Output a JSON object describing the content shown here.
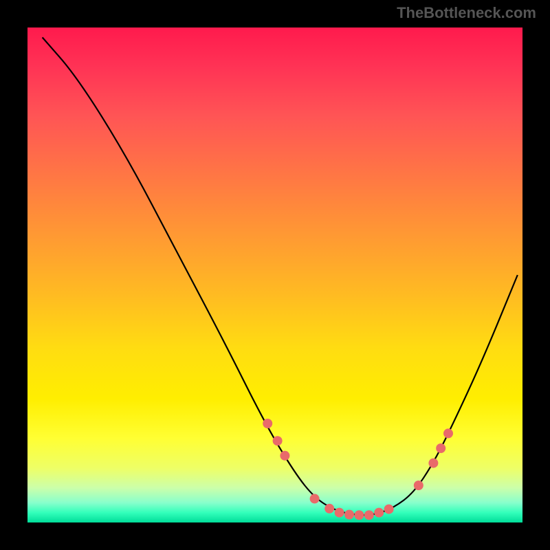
{
  "attribution": "TheBottleneck.com",
  "chart_data": {
    "type": "line",
    "title": "",
    "xlabel": "",
    "ylabel": "",
    "xlim": [
      0,
      100
    ],
    "ylim": [
      0,
      100
    ],
    "curve": [
      {
        "x": 3,
        "y": 98
      },
      {
        "x": 10,
        "y": 90
      },
      {
        "x": 20,
        "y": 74
      },
      {
        "x": 30,
        "y": 55
      },
      {
        "x": 40,
        "y": 36
      },
      {
        "x": 48,
        "y": 20
      },
      {
        "x": 54,
        "y": 10
      },
      {
        "x": 58,
        "y": 5
      },
      {
        "x": 62,
        "y": 2.5
      },
      {
        "x": 66,
        "y": 1.5
      },
      {
        "x": 70,
        "y": 1.5
      },
      {
        "x": 74,
        "y": 3
      },
      {
        "x": 78,
        "y": 6
      },
      {
        "x": 82,
        "y": 12
      },
      {
        "x": 86,
        "y": 20
      },
      {
        "x": 92,
        "y": 33
      },
      {
        "x": 99,
        "y": 50
      }
    ],
    "markers": [
      {
        "x": 48.5,
        "y": 20
      },
      {
        "x": 50.5,
        "y": 16.5
      },
      {
        "x": 52,
        "y": 13.5
      },
      {
        "x": 58,
        "y": 4.8
      },
      {
        "x": 61,
        "y": 2.8
      },
      {
        "x": 63,
        "y": 2.0
      },
      {
        "x": 65,
        "y": 1.6
      },
      {
        "x": 67,
        "y": 1.5
      },
      {
        "x": 69,
        "y": 1.5
      },
      {
        "x": 71,
        "y": 2.0
      },
      {
        "x": 73,
        "y": 2.7
      },
      {
        "x": 79,
        "y": 7.5
      },
      {
        "x": 82,
        "y": 12
      },
      {
        "x": 83.5,
        "y": 15
      },
      {
        "x": 85,
        "y": 18
      }
    ],
    "marker_color": "#e96a6a",
    "curve_color": "#000000"
  }
}
